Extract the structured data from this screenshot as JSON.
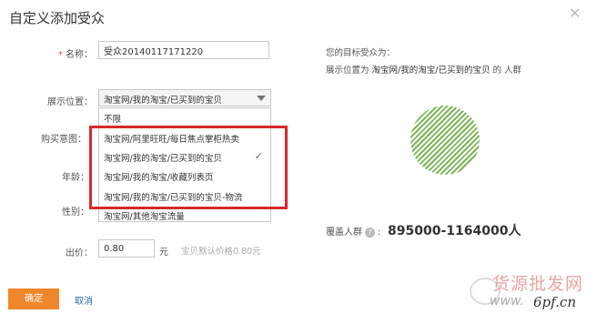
{
  "dialog": {
    "title": "自定义添加受众",
    "close_icon": "close-icon"
  },
  "form": {
    "name_label": "名称：",
    "name_required": "*",
    "name_value": "受众20140117171220",
    "position_label": "展示位置：",
    "position_selected": "淘宝网/我的淘宝/已买到的宝贝",
    "intent_label": "购买意图：",
    "age_label": "年龄：",
    "gender_label": "性别：",
    "price_label": "出价：",
    "price_value": "0.80",
    "price_unit": "元",
    "price_hint": "宝贝默认价格0.80元"
  },
  "dropdown": {
    "options": [
      "不限",
      "淘宝网/阿里旺旺/每日焦点掌柜热卖",
      "淘宝网/我的淘宝/已买到的宝贝",
      "淘宝网/我的淘宝/收藏列表页",
      "淘宝网/我的淘宝/已买到的宝贝-物流",
      "淘宝网/其他淘宝流量"
    ],
    "selected_index": 2,
    "check_icon": "✓"
  },
  "summary": {
    "target_heading": "您的目标受众为：",
    "target_prefix": "展示位置为",
    "target_value": "淘宝网/我的淘宝/已买到的宝贝",
    "target_suffix": "的 人群",
    "coverage_label": "覆盖人群",
    "coverage_value": "895000-1164000人",
    "help_icon": "?"
  },
  "footer": {
    "ok_label": "确定",
    "cancel_label": "取消"
  },
  "watermark": {
    "line1": "货源批发网",
    "site_prefix": "www.",
    "site_main": "6pf.cn"
  },
  "colors": {
    "accent": "#f0862b",
    "link": "#2a6bb5",
    "highlight": "#d8282c",
    "pie": "#7db55a"
  }
}
